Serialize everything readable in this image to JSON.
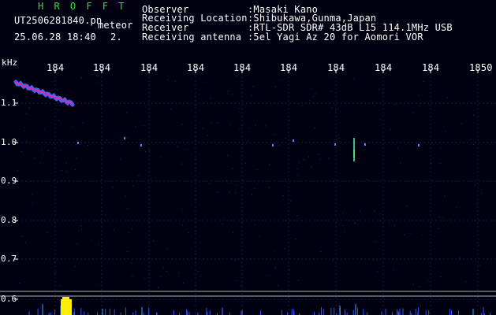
{
  "header": {
    "brand": "H R O F F T",
    "filename": "UT2506281840.pn",
    "mode": "meteor",
    "datetime": "25.06.28 18:40",
    "count": "2.",
    "fields": [
      {
        "label": "Observer",
        "value": ":Masaki Kano"
      },
      {
        "label": "Receiving Location",
        "value": ":Shibukawa,Gunma,Japan"
      },
      {
        "label": "Receiver",
        "value": ":RTL-SDR SDR# 43dB L15 114.1MHz USB"
      },
      {
        "label": "Receiving antenna",
        "value": ":5el Yagi Az 20 for Aomori VOR"
      }
    ]
  },
  "axes": {
    "y_unit": "kHz",
    "y_ticks": [
      "1.1",
      "1.0",
      "0.9",
      "0.8",
      "0.7",
      "0.6"
    ],
    "x_ticks": [
      "184",
      "184",
      "184",
      "184",
      "184",
      "184",
      "184",
      "184",
      "184",
      "1850"
    ]
  },
  "colors": {
    "background": "#000010",
    "grid": "#1c1c40",
    "brand": "#33dd44",
    "trace_main": "#4060ff",
    "trace_highlight": "#ff2080",
    "burst": "#ffee00"
  }
}
